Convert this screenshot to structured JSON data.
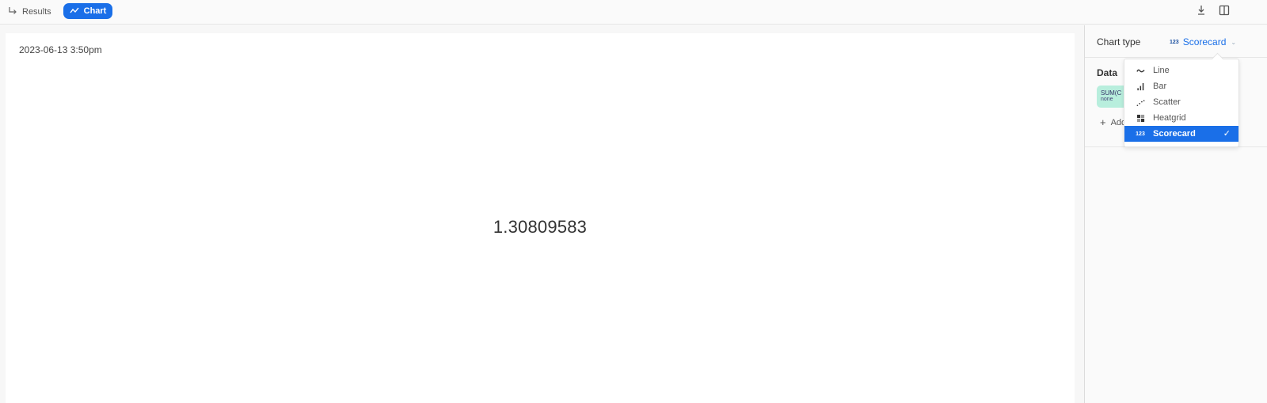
{
  "toolbar": {
    "results_label": "Results",
    "chart_label": "Chart",
    "download_icon": "download-icon",
    "panel_icon": "split-panel-icon"
  },
  "chart": {
    "timestamp": "2023-06-13 3:50pm",
    "score_value": "1.30809583"
  },
  "panel": {
    "chart_type_label": "Chart type",
    "chart_type_value": "Scorecard",
    "chart_type_icon_text": "123",
    "data_title": "Data",
    "data_pill_top": "SUM(C",
    "data_pill_bottom": "none",
    "add_label": "Add"
  },
  "dropdown": {
    "items": [
      {
        "label": "Line",
        "icon": "line-chart-icon"
      },
      {
        "label": "Bar",
        "icon": "bar-chart-icon"
      },
      {
        "label": "Scatter",
        "icon": "scatter-chart-icon"
      },
      {
        "label": "Heatgrid",
        "icon": "heatgrid-icon"
      },
      {
        "label": "Scorecard",
        "icon": "scorecard-icon",
        "icon_text": "123",
        "selected": true
      }
    ],
    "check_mark": "✓"
  },
  "colors": {
    "accent": "#1a6fe8",
    "pill": "#b8eedd"
  }
}
